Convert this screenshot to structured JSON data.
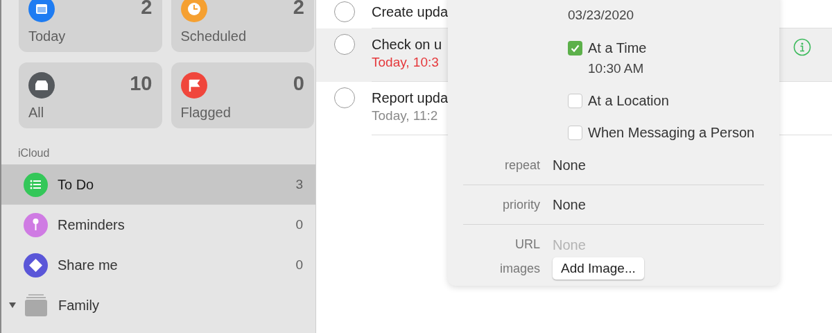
{
  "sidebar": {
    "smart_lists": [
      {
        "label": "Today",
        "count": "2",
        "kind": "today",
        "color": "#1e7cf2"
      },
      {
        "label": "Scheduled",
        "count": "2",
        "kind": "scheduled",
        "color": "#f5a031"
      },
      {
        "label": "All",
        "count": "10",
        "kind": "all",
        "color": "#55595d"
      },
      {
        "label": "Flagged",
        "count": "0",
        "kind": "flagged",
        "color": "#f0463c"
      }
    ],
    "section": "iCloud",
    "lists": [
      {
        "name": "To Do",
        "count": "3",
        "kind": "bullets",
        "color": "#34c759",
        "selected": true
      },
      {
        "name": "Reminders",
        "count": "0",
        "kind": "pin",
        "color": "#cf7be3",
        "selected": false
      },
      {
        "name": "Share me",
        "count": "0",
        "kind": "diamond",
        "color": "#5a56d8",
        "selected": false
      },
      {
        "name": "Family",
        "kind": "group",
        "expanded": true,
        "selected": false
      }
    ]
  },
  "tasks": [
    {
      "title": "Create upda",
      "selected": false
    },
    {
      "title": "Check on u",
      "due": "Today, 10:3",
      "overdue": true,
      "selected": true
    },
    {
      "title": "Report upda",
      "due": "Today, 11:2",
      "overdue": false,
      "selected": false
    }
  ],
  "details": {
    "date": "03/23/2020",
    "options": [
      {
        "label": "At a Time",
        "checked": true,
        "detail": "10:30 AM"
      },
      {
        "label": "At a Location",
        "checked": false
      },
      {
        "label": "When Messaging a Person",
        "checked": false
      }
    ],
    "fields": [
      {
        "label": "repeat",
        "value": "None"
      },
      {
        "label": "priority",
        "value": "None"
      },
      {
        "label": "URL",
        "placeholder": "None"
      }
    ],
    "images": {
      "label": "images",
      "button": "Add Image..."
    }
  }
}
